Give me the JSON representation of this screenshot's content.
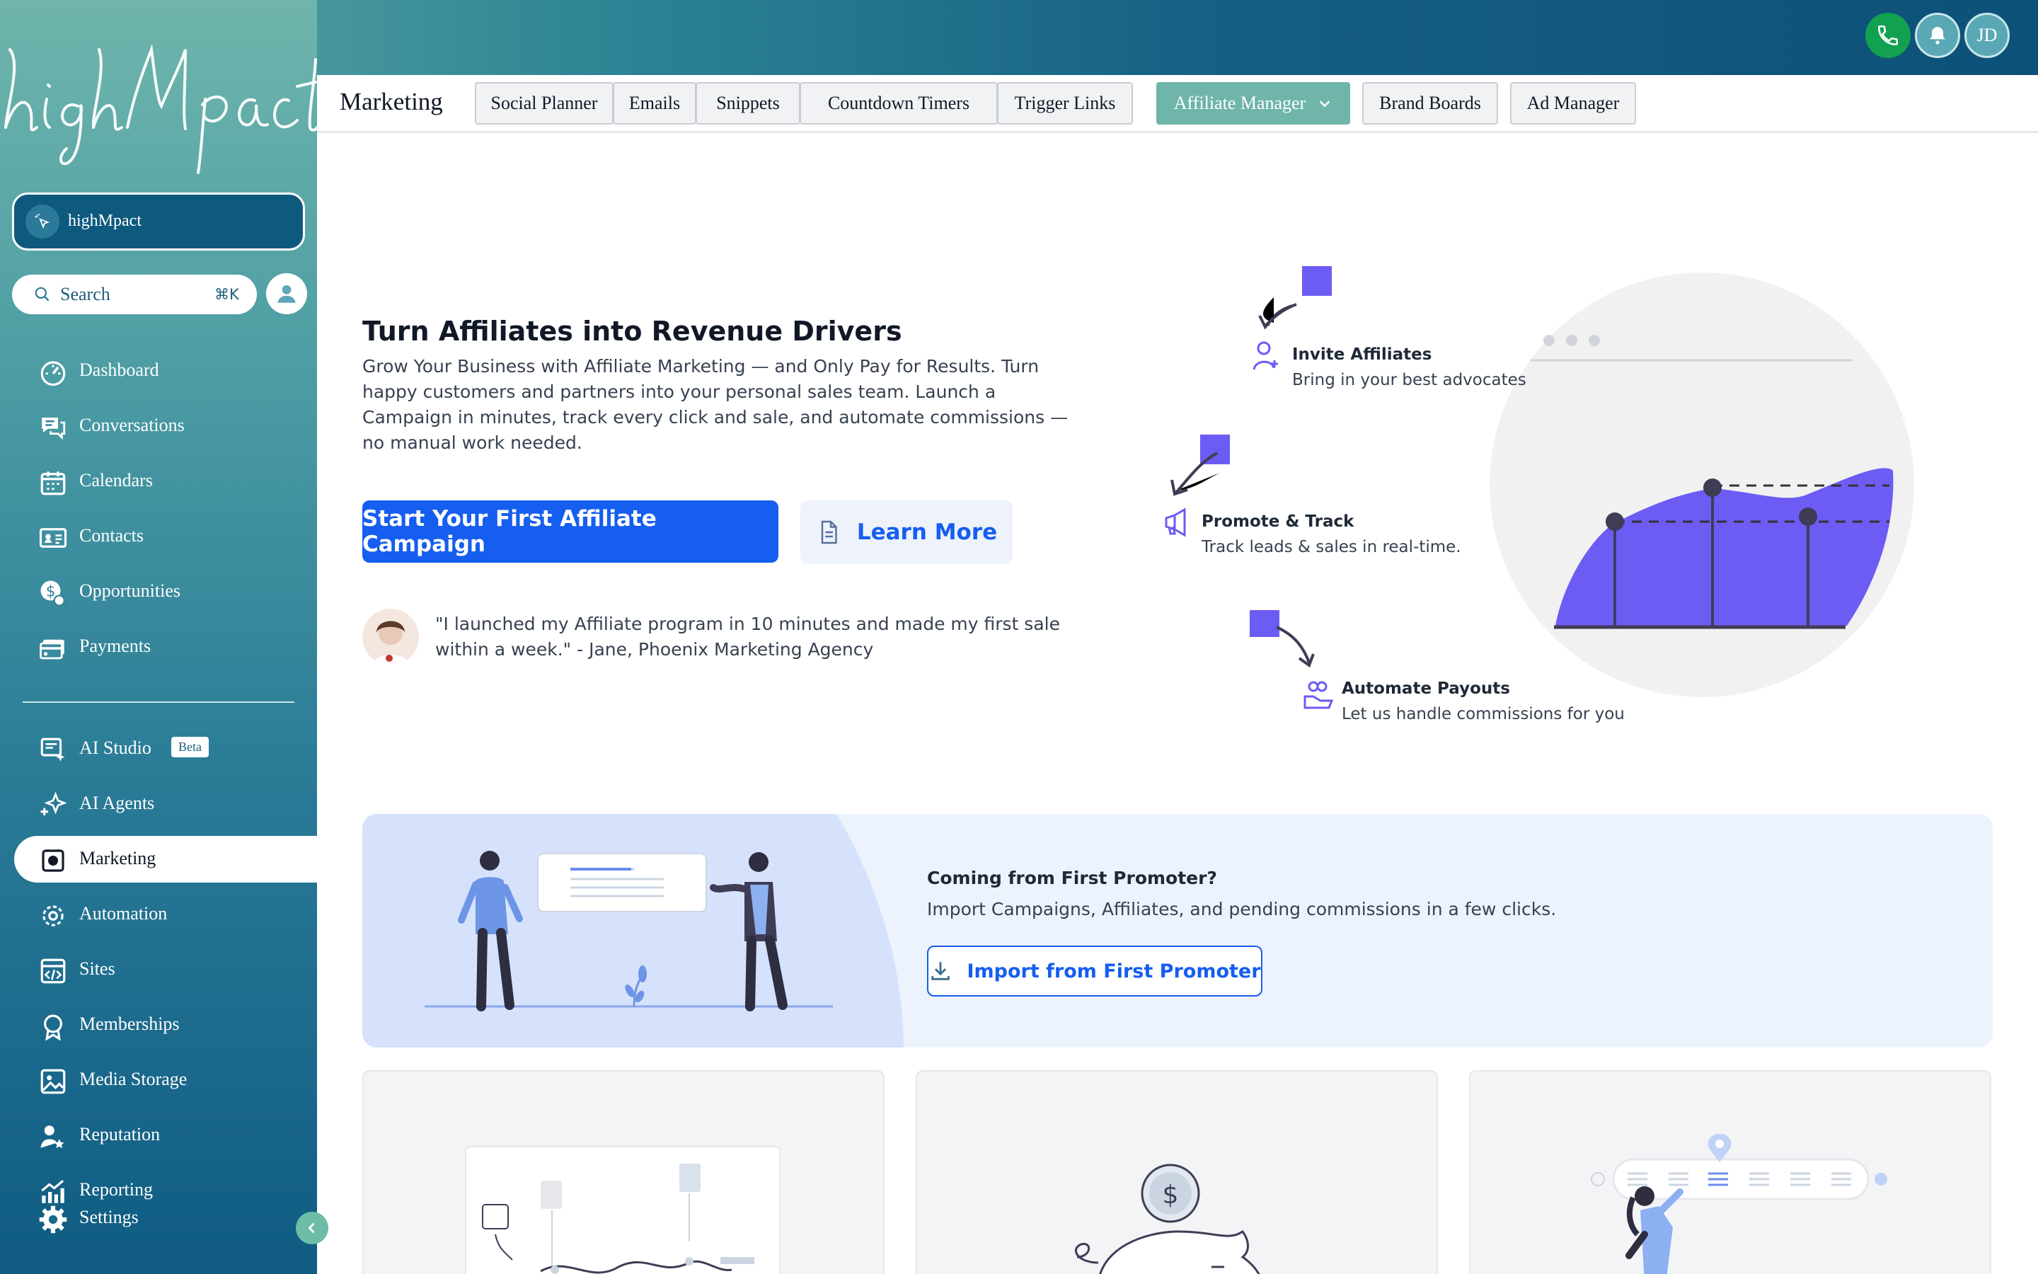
{
  "brand": {
    "logo_text": "highMpact",
    "account_name": "highMpact"
  },
  "topbar": {
    "avatar_initials": "JD",
    "phone_color": "#12a150"
  },
  "search": {
    "placeholder": "Search",
    "shortcut": "⌘K"
  },
  "sidebar": {
    "items": [
      {
        "label": "Dashboard",
        "icon": "dashboard-icon"
      },
      {
        "label": "Conversations",
        "icon": "chat-icon"
      },
      {
        "label": "Calendars",
        "icon": "calendar-icon"
      },
      {
        "label": "Contacts",
        "icon": "contacts-icon"
      },
      {
        "label": "Opportunities",
        "icon": "opportunities-icon"
      },
      {
        "label": "Payments",
        "icon": "payments-icon"
      },
      {
        "label": "AI Studio",
        "icon": "ai-studio-icon",
        "badge": "Beta"
      },
      {
        "label": "AI Agents",
        "icon": "sparkles-icon"
      },
      {
        "label": "Marketing",
        "icon": "marketing-icon",
        "active": true
      },
      {
        "label": "Automation",
        "icon": "automation-icon"
      },
      {
        "label": "Sites",
        "icon": "sites-icon"
      },
      {
        "label": "Memberships",
        "icon": "memberships-icon"
      },
      {
        "label": "Media Storage",
        "icon": "media-icon"
      },
      {
        "label": "Reputation",
        "icon": "reputation-icon"
      },
      {
        "label": "Reporting",
        "icon": "reporting-icon"
      },
      {
        "label": "Settings",
        "icon": "gear-icon"
      }
    ]
  },
  "header": {
    "title": "Marketing",
    "tabs": [
      {
        "label": "Social Planner"
      },
      {
        "label": "Emails"
      },
      {
        "label": "Snippets"
      },
      {
        "label": "Countdown Timers"
      },
      {
        "label": "Trigger Links"
      },
      {
        "label": "Affiliate Manager",
        "active": true
      },
      {
        "label": "Brand Boards"
      },
      {
        "label": "Ad Manager"
      }
    ]
  },
  "hero": {
    "title": "Turn Affiliates into Revenue Drivers",
    "description": "Grow Your Business with Affiliate Marketing — and Only Pay for Results. Turn happy customers and partners into your personal sales team. Launch a Campaign in minutes, track every click and sale, and automate commissions — no manual work needed.",
    "primary_cta": "Start Your First Affiliate Campaign",
    "secondary_cta": "Learn More",
    "testimonial": "\"I launched my Affiliate program in 10 minutes and made my first sale within a week.\" - Jane, Phoenix Marketing Agency"
  },
  "features": [
    {
      "title": "Invite Affiliates",
      "subtitle": "Bring in your best advocates"
    },
    {
      "title": "Promote & Track",
      "subtitle": "Track leads & sales in real-time."
    },
    {
      "title": "Automate Payouts",
      "subtitle": "Let us handle commissions for you"
    }
  ],
  "import_banner": {
    "title": "Coming from First Promoter?",
    "description": "Import Campaigns, Affiliates, and pending commissions in a few clicks.",
    "button": "Import from First Promoter"
  },
  "colors": {
    "accent": "#155eef",
    "purple": "#6c5cf3",
    "active_tab": "#6fb5a9"
  }
}
